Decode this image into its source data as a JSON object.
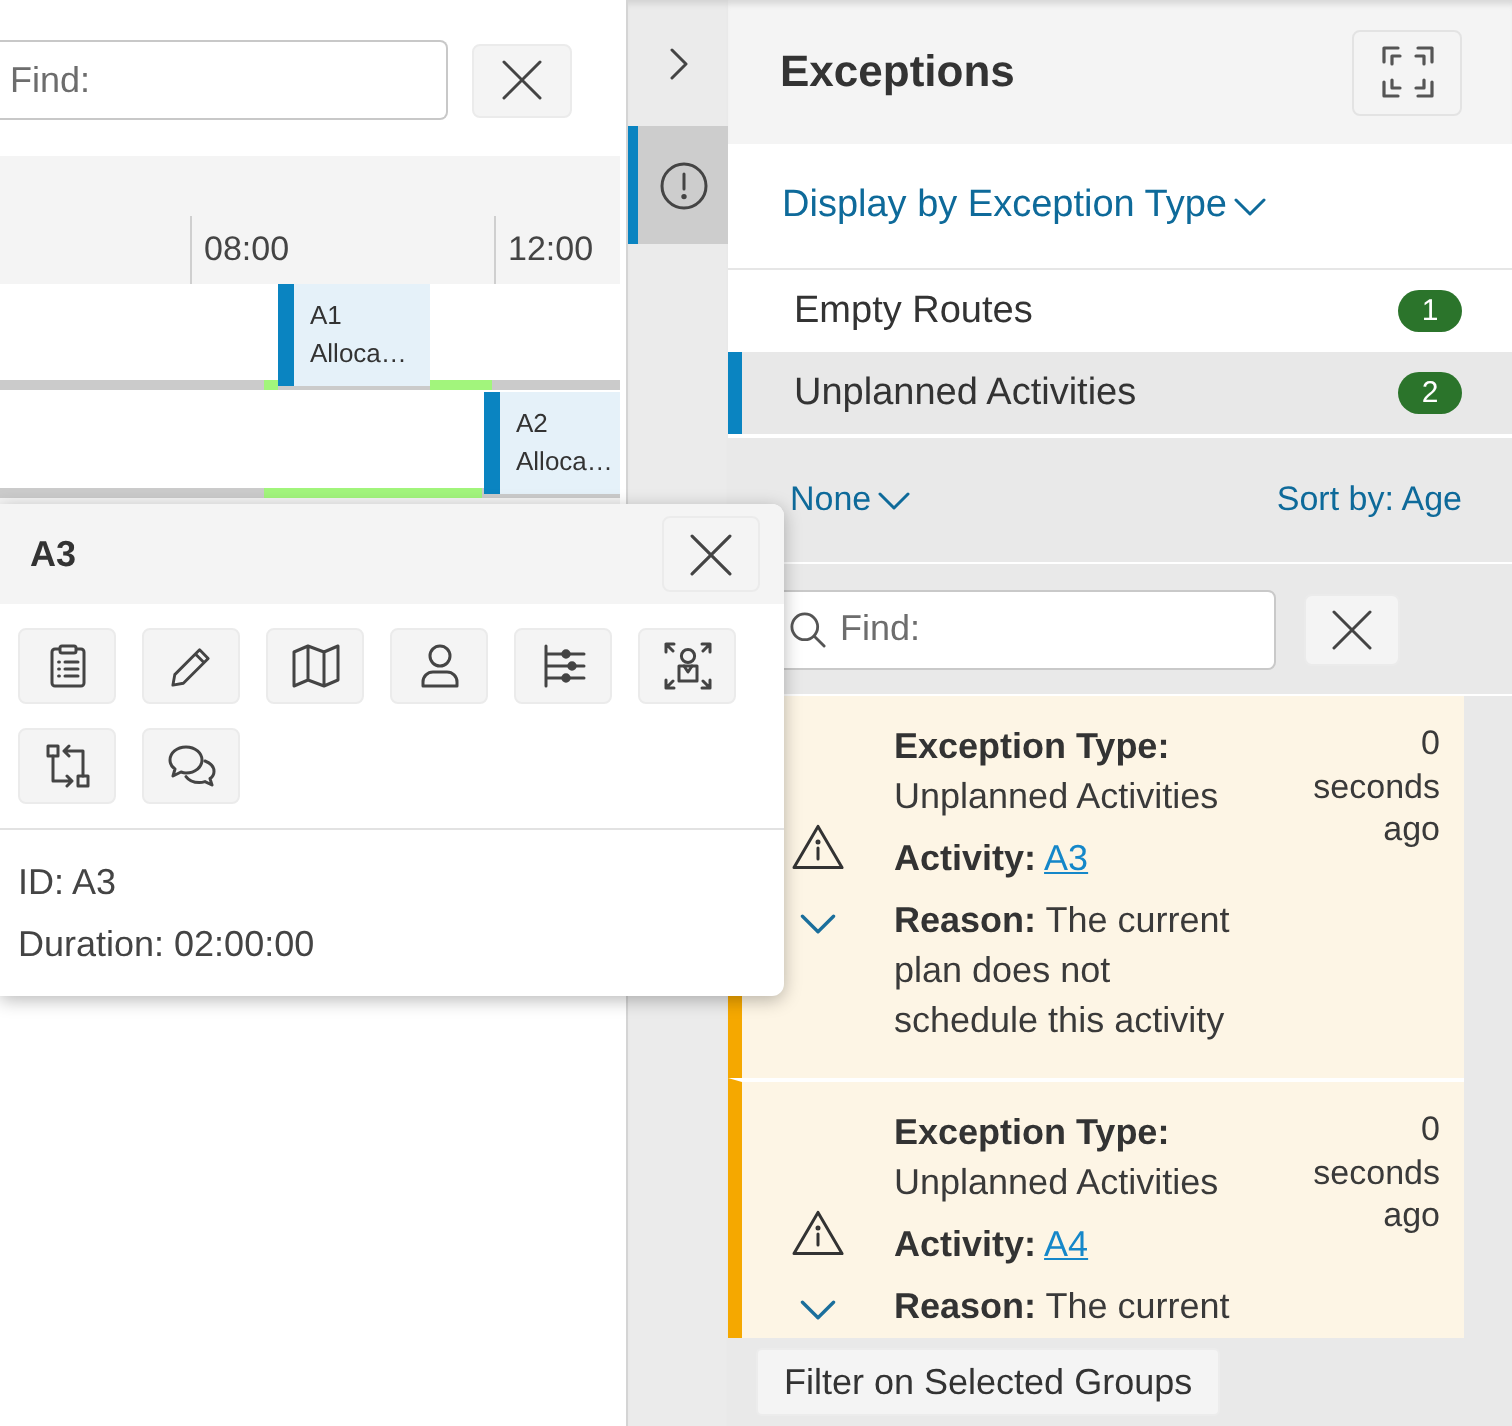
{
  "schedule": {
    "search": {
      "placeholder": "Find:"
    },
    "timeline": {
      "ticks": [
        "08:00",
        "12:00"
      ],
      "rows": [
        {
          "activities": [
            {
              "id": "A1",
              "label": "Alloca…"
            }
          ]
        },
        {
          "activities": [
            {
              "id": "A2",
              "label": "Alloca…"
            }
          ]
        }
      ]
    }
  },
  "activity_popup": {
    "title": "A3",
    "details": [
      "ID: A3",
      "Duration: 02:00:00"
    ]
  },
  "side_tabs": [
    {
      "kind": "exceptions",
      "selected": true
    }
  ],
  "exceptions": {
    "title": "Exceptions",
    "display_by": "Display by Exception Type",
    "groups": [
      {
        "label": "Empty Routes",
        "count": "1",
        "selected": false
      },
      {
        "label": "Unplanned Activities",
        "count": "2",
        "selected": true
      }
    ],
    "group_by": "None",
    "sort_by": "Sort by: Age",
    "search": {
      "placeholder": "Find:"
    },
    "items": [
      {
        "type_label": "Exception Type:",
        "type": "Unplanned Activities",
        "activity_label": "Activity:",
        "activity": "A3",
        "reason_label": "Reason:",
        "reason": "The current plan does not schedule this activity",
        "age": "0 seconds ago"
      },
      {
        "type_label": "Exception Type:",
        "type": "Unplanned Activities",
        "activity_label": "Activity:",
        "activity": "A4",
        "reason_label": "Reason:",
        "reason": "The current",
        "age": "0 seconds ago"
      }
    ],
    "filter_button": "Filter on Selected Groups"
  }
}
